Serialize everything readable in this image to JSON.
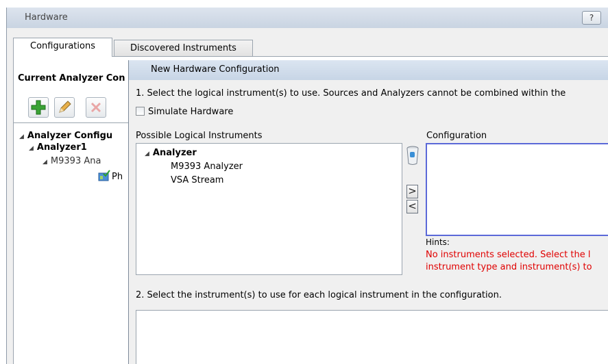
{
  "window": {
    "title": "Hardware",
    "help_label": "?"
  },
  "tabs": {
    "configurations": "Configurations",
    "discovered": "Discovered Instruments"
  },
  "left": {
    "current_label": "Current Analyzer Con",
    "tree": [
      {
        "label": "Analyzer Configu",
        "bold": true
      },
      {
        "label": "Analyzer1",
        "bold": true
      },
      {
        "label": "M9393 Ana",
        "bold": false
      },
      {
        "label": "Ph",
        "bold": false
      }
    ]
  },
  "dialog": {
    "title": "New Hardware Configuration",
    "step1": "1. Select the logical instrument(s) to use.  Sources and Analyzers cannot be combined within the",
    "simulate_label": "Simulate Hardware",
    "possible_label": "Possible Logical Instruments",
    "possible_tree": {
      "root": "Analyzer",
      "children": [
        "M9393 Analyzer",
        "VSA Stream"
      ]
    },
    "config_label": "Configuration",
    "move_right": ">",
    "move_left": "<",
    "hints_label": "Hints:",
    "hints_line1": "No instruments selected.  Select the l",
    "hints_line2": "instrument type and instrument(s) to",
    "step2": "2. Select the instrument(s) to use for each logical instrument in the configuration."
  },
  "colors": {
    "hint_red": "#e00000",
    "focus_blue": "#5a68d8"
  }
}
